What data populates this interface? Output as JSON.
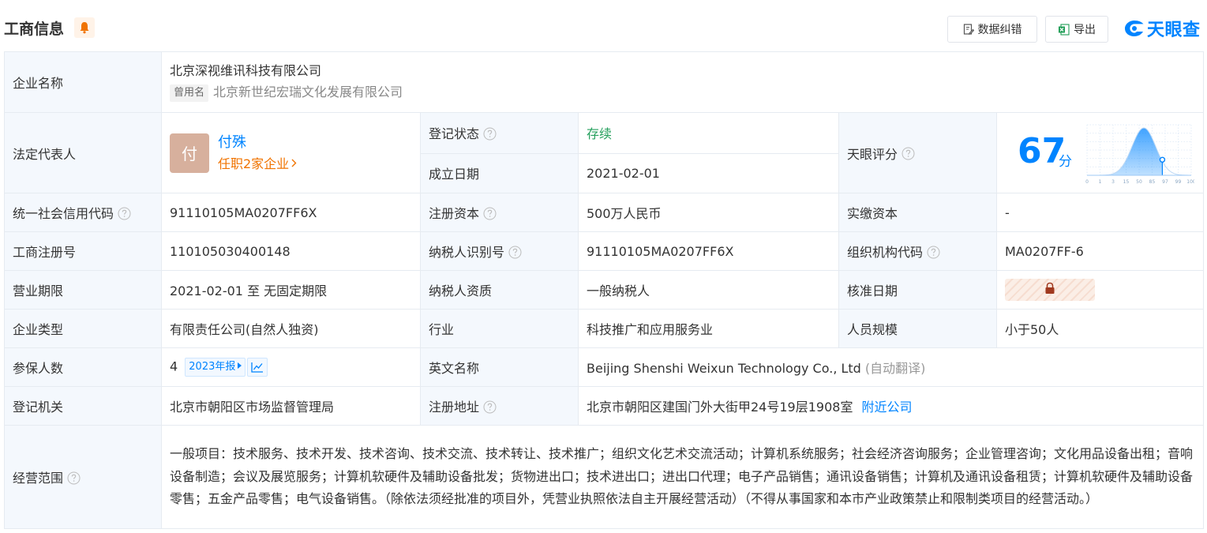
{
  "header": {
    "title": "工商信息",
    "correct_label": "数据纠错",
    "export_label": "导出",
    "logo_text": "天眼查",
    "accent_color": "#0084ff"
  },
  "company": {
    "name_label": "企业名称",
    "name": "北京深视维讯科技有限公司",
    "former_tag": "曾用名",
    "former_name": "北京新世纪宏瑞文化发展有限公司",
    "rep_label": "法定代表人",
    "rep_avatar": "付",
    "rep_name": "付殊",
    "rep_jobs": "任职2家企业",
    "status_label": "登记状态",
    "status": "存续",
    "founded_label": "成立日期",
    "founded": "2021-02-01",
    "score_label": "天眼评分",
    "score": "67",
    "score_unit": "分",
    "credit_code_label": "统一社会信用代码",
    "credit_code": "91110105MA0207FF6X",
    "reg_capital_label": "注册资本",
    "reg_capital": "500万人民币",
    "paid_capital_label": "实缴资本",
    "paid_capital": "-",
    "reg_no_label": "工商注册号",
    "reg_no": "110105030400148",
    "taxpayer_id_label": "纳税人识别号",
    "taxpayer_id": "91110105MA0207FF6X",
    "org_code_label": "组织机构代码",
    "org_code": "MA0207FF-6",
    "term_label": "营业期限",
    "term": "2021-02-01 至 无固定期限",
    "taxpayer_type_label": "纳税人资质",
    "taxpayer_type": "一般纳税人",
    "approve_label": "核准日期",
    "type_label": "企业类型",
    "type": "有限责任公司(自然人独资)",
    "industry_label": "行业",
    "industry": "科技推广和应用服务业",
    "staff_label": "人员规模",
    "staff": "小于50人",
    "insured_label": "参保人数",
    "insured": "4",
    "insured_year": "2023年报",
    "english_label": "英文名称",
    "english": "Beijing Shenshi Weixun Technology Co., Ltd",
    "english_note": "(自动翻译)",
    "authority_label": "登记机关",
    "authority": "北京市朝阳区市场监督管理局",
    "address_label": "注册地址",
    "address": "北京市朝阳区建国门外大街甲24号19层1908室",
    "nearby": "附近公司",
    "scope_label": "经营范围",
    "scope": "一般项目：技术服务、技术开发、技术咨询、技术交流、技术转让、技术推广；组织文化艺术交流活动；计算机系统服务；社会经济咨询服务；企业管理咨询；文化用品设备出租；音响设备制造；会议及展览服务；计算机软硬件及辅助设备批发；货物进出口；技术进出口；进出口代理；电子产品销售；通讯设备销售；计算机及通讯设备租赁；计算机软硬件及辅助设备零售；五金产品零售；电气设备销售。（除依法须经批准的项目外，凭营业执照依法自主开展经营活动）（不得从事国家和本市产业政策禁止和限制类项目的经营活动。）"
  },
  "score_chart": {
    "x_ticks": [
      "0",
      "1",
      "3",
      "15",
      "50",
      "85",
      "97",
      "99",
      "100"
    ],
    "marker_value": 67,
    "curve_color": "#0084ff"
  }
}
